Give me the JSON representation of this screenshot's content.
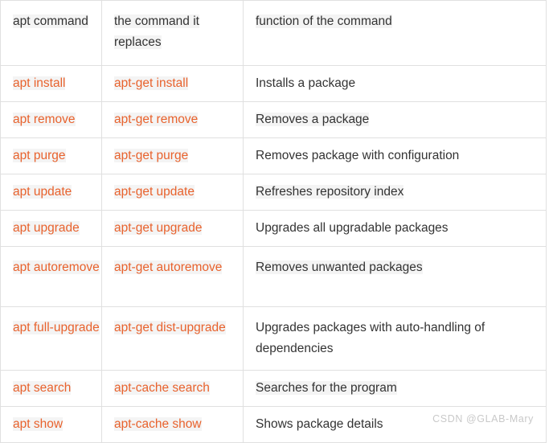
{
  "table": {
    "columns": [
      {
        "key": "command",
        "label": "apt command"
      },
      {
        "key": "replaces",
        "label": "the command it replaces"
      },
      {
        "key": "function",
        "label": "function of the command"
      }
    ],
    "rows": [
      {
        "command": "apt install",
        "replaces": "apt-get install",
        "function": "Installs a package"
      },
      {
        "command": "apt remove",
        "replaces": "apt-get remove",
        "function": "Removes a package"
      },
      {
        "command": "apt purge",
        "replaces": "apt-get purge",
        "function": "Removes package with configuration"
      },
      {
        "command": "apt update",
        "replaces": "apt-get update",
        "function": "Refreshes repository index"
      },
      {
        "command": "apt upgrade",
        "replaces": "apt-get upgrade",
        "function": "Upgrades all upgradable packages"
      },
      {
        "command": "apt autoremove",
        "replaces": "apt-get autoremove",
        "function": "Removes unwanted packages"
      },
      {
        "command": "apt full-upgrade",
        "replaces": "apt-get dist-upgrade",
        "function": "Upgrades packages with auto-handling of dependencies"
      },
      {
        "command": "apt search",
        "replaces": "apt-cache search",
        "function": "Searches for the program"
      },
      {
        "command": "apt show",
        "replaces": "apt-cache show",
        "function": "Shows package details"
      }
    ]
  },
  "watermark": {
    "text": "CSDN @GLAB-Mary"
  },
  "colors": {
    "command_text": "#e8622d",
    "body_text": "#333333",
    "border": "#e0e0e0",
    "text_highlight": "#f4f4f4",
    "watermark_text": "#c9c9c9",
    "background": "#ffffff"
  }
}
